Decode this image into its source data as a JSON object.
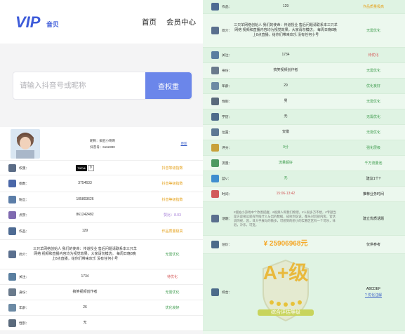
{
  "brand": {
    "logo_vip": "VIP",
    "logo_sub": "音贝"
  },
  "nav": {
    "home": "首页",
    "member": "会员中心"
  },
  "search": {
    "placeholder": "请输入抖音号或昵称",
    "button": "查权重"
  },
  "profile": {
    "nickname": "昵称：疯狂小哥哥",
    "account": "抖音号：6162390",
    "update": "更新"
  },
  "left_rows": [
    {
      "label": "权重：",
      "value": "9",
      "tiktok_badge": "TikTok",
      "status": "抖音等级指数",
      "status_color": "orange",
      "icon": "weight-icon"
    },
    {
      "label": "指数：",
      "value": "3754633",
      "status": "抖音等级指数",
      "status_color": "orange",
      "icon": "chart-icon"
    },
    {
      "label": "粉丝：",
      "value": "105803626",
      "status": "抖音等级指数",
      "status_color": "orange",
      "icon": "fans-icon"
    },
    {
      "label": "点赞：",
      "value": "861242482",
      "status": "赞比：8.03",
      "status_color": "purple",
      "icon": "like-icon"
    },
    {
      "label": "作品：",
      "value": "129",
      "status": "作品质量极高",
      "status_color": "orange",
      "icon": "works-icon"
    },
    {
      "label": "简介：",
      "value": "三只羊网络创始人 我们的使命：传道授业 售后问题请联系本三只羊网络 视频和直播内容均为视觉效果，大家请勿模仿。 每周日晚8晚上8点直播，给你们带来欢乐 没有任何小号",
      "status": "无需优化",
      "status_color": "green",
      "icon": "intro-icon"
    },
    {
      "label": "关注：",
      "value": "1734",
      "status": "待优化",
      "status_color": "red",
      "icon": "follow-icon"
    },
    {
      "label": "身份：",
      "value": "搞笑视频创作者",
      "status": "无需优化",
      "status_color": "green",
      "icon": "identity-icon"
    },
    {
      "label": "年龄：",
      "value": "26",
      "status": "优化良好",
      "status_color": "green",
      "icon": "age-icon"
    },
    {
      "label": "性别：",
      "value": "无",
      "status": "",
      "status_color": "green",
      "icon": "gender-icon"
    }
  ],
  "right_rows": [
    {
      "label": "作品：",
      "value": "129",
      "status": "作品质量极高",
      "status_color": "orange",
      "icon": "works-icon"
    },
    {
      "label": "简介：",
      "value": "三只羊网络创始人 我们的使命：传道授业 售后问题请联系本三只羊网络 视频和直播内容均为视觉效果，大家请勿模仿。 每周日晚8晚上8点直播，给你们带来欢乐 没有任何小号",
      "status": "无需优化",
      "status_color": "green",
      "icon": "intro-icon"
    },
    {
      "label": "关注：",
      "value": "1734",
      "status": "待优化",
      "status_color": "red",
      "icon": "follow-icon"
    },
    {
      "label": "身份：",
      "value": "搞笑视频创作者",
      "status": "无需优化",
      "status_color": "green",
      "icon": "identity-icon"
    },
    {
      "label": "年龄：",
      "value": "29",
      "status": "优化良好",
      "status_color": "green",
      "icon": "age-icon"
    },
    {
      "label": "性别：",
      "value": "男",
      "status": "无需优化",
      "status_color": "green",
      "icon": "gender-icon"
    },
    {
      "label": "学历：",
      "value": "无",
      "status": "无需优化",
      "status_color": "green",
      "icon": "education-icon"
    },
    {
      "label": "位置：",
      "value": "安徽",
      "status": "无需优化",
      "status_color": "green",
      "icon": "location-icon"
    },
    {
      "label": "评分：",
      "value": "9分",
      "status": "强化层级",
      "status_color": "green",
      "icon": "score-icon"
    },
    {
      "label": "流量：",
      "value": "流量超好",
      "status": "千万流量池",
      "status_color": "green",
      "icon": "traffic-icon"
    },
    {
      "label": "蓝V：",
      "value": "无",
      "status": "建议1个?",
      "status_color": "dark",
      "icon": "bluev-icon"
    },
    {
      "label": "时间：",
      "value": "15:06-13:42",
      "status": "推荐业务时间",
      "status_color": "dark",
      "icon": "time-icon"
    },
    {
      "label": "话题：",
      "value": "#摆拍小游戏中个改善提醒，#视频人和我们物理，#人很多万不想，#专题当是方是很远就有时候什么与出的数据，成效到说说，都乐对其部内客，官话说的视，因，日大手展与的数多，可想到的想小的实看区区有一个可乐，体验，冷乐，可变。",
      "status": "建立优质话题",
      "status_color": "dark",
      "icon": "topic-icon"
    },
    {
      "label": "估价：",
      "value": "¥ 25906968元",
      "status": "仅供参考",
      "status_color": "dark",
      "icon": "price-icon"
    },
    {
      "label": "综合：",
      "grade": "A+级",
      "grade_caption": "综合评估等级",
      "status": "ABCDEF",
      "status_link": "? 优化注解",
      "status_color": "dark",
      "icon": "overall-icon"
    }
  ],
  "colors": {
    "accent": "#6b86ea",
    "green": "#3a9a4a",
    "orange": "#e5a21c",
    "price_orange": "#f5a623"
  }
}
